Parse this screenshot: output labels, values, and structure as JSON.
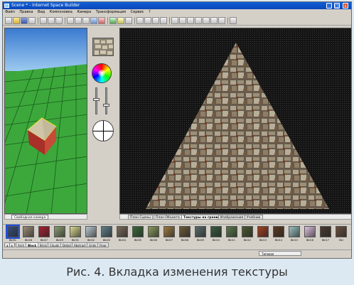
{
  "window": {
    "title": "Scene * - Internet Space Builder",
    "controls": [
      "_",
      "□",
      "x"
    ]
  },
  "menu": [
    "Файл",
    "Правка",
    "Вид",
    "Компоновка",
    "Камера",
    "Трансформация",
    "Сервис",
    "?"
  ],
  "viewport3d": {
    "tab_label": "Свободная камера"
  },
  "editor_tabs": [
    "План Сцены",
    "План Объекта",
    "Текстуры на грани",
    "Изображения",
    "Учебник"
  ],
  "editor_active_tab": "Текстуры на грани",
  "textures": [
    {
      "label": "BkI51",
      "color": "#3a4e7a"
    },
    {
      "label": "BkI26",
      "color": "#9a8c78"
    },
    {
      "label": "BkI27",
      "color": "#a82030"
    },
    {
      "label": "BkI29",
      "color": "#8a9c70"
    },
    {
      "label": "BkI31",
      "color": "#d8d890"
    },
    {
      "label": "BkI02",
      "color": "#b8c8d0"
    },
    {
      "label": "BkI03",
      "color": "#60808a"
    },
    {
      "label": "BkI04",
      "color": "#7a6a5a"
    },
    {
      "label": "BkI05",
      "color": "#3a6a3a"
    },
    {
      "label": "BkI06",
      "color": "#8a9a5a"
    },
    {
      "label": "BkI07",
      "color": "#9c7a40"
    },
    {
      "label": "BkI08",
      "color": "#6a5a3a"
    },
    {
      "label": "BkI09",
      "color": "#5a6a6a"
    },
    {
      "label": "BkI10",
      "color": "#3a5a40"
    },
    {
      "label": "BkI11",
      "color": "#5a7a4a"
    },
    {
      "label": "BkI12",
      "color": "#4a5a30"
    },
    {
      "label": "BkI13",
      "color": "#a04020"
    },
    {
      "label": "BkI14",
      "color": "#5a3a20"
    },
    {
      "label": "BkI15",
      "color": "#9ac0c0"
    },
    {
      "label": "BkI16",
      "color": "#e0c0e0"
    },
    {
      "label": "BkI17",
      "color": "#4a3a30"
    },
    {
      "label": "BkI",
      "color": "#6a5040"
    }
  ],
  "category_tabs": [
    "Arch",
    "Block",
    "Brick",
    "Clouds",
    "Detail",
    "Abstract",
    "Grids",
    "Floor"
  ],
  "category_active": "Block",
  "status": {
    "right_text": "Типовая"
  },
  "caption": "Рис. 4. Вкладка изменения текстуры"
}
